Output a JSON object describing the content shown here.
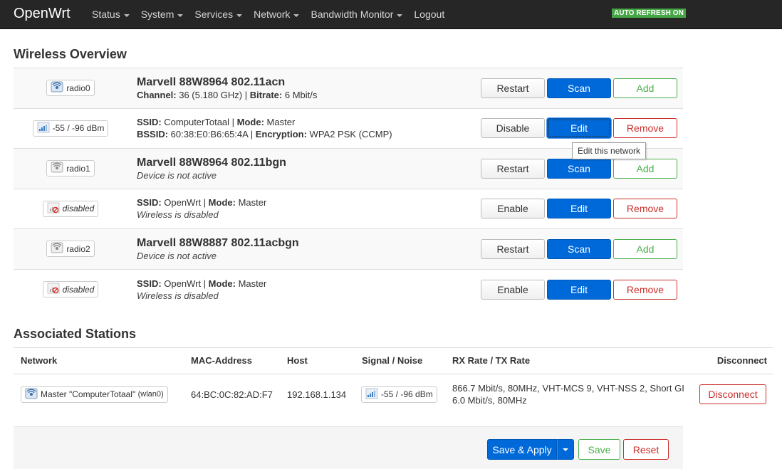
{
  "navbar": {
    "brand": "OpenWrt",
    "menu": [
      {
        "label": "Status",
        "dropdown": true
      },
      {
        "label": "System",
        "dropdown": true
      },
      {
        "label": "Services",
        "dropdown": true
      },
      {
        "label": "Network",
        "dropdown": true
      },
      {
        "label": "Bandwidth Monitor",
        "dropdown": true
      },
      {
        "label": "Logout",
        "dropdown": false
      }
    ],
    "auto_refresh": "AUTO REFRESH ON"
  },
  "wireless": {
    "title": "Wireless Overview",
    "rows": [
      {
        "badge": "radio0",
        "badge_icon": "wifi-radio-active-icon",
        "title": "Marvell 88W8964 802.11acn",
        "l1": {
          "k1": "Channel:",
          "v1": " 36 (5.180 GHz) | ",
          "k2": "Bitrate:",
          "v2": " 6 Mbit/s"
        },
        "buttons": [
          "Restart",
          "Scan",
          "Add"
        ]
      },
      {
        "badge": "-55 / -96 dBm",
        "badge_icon": "signal-bars-icon",
        "l1": {
          "k1": "SSID:",
          "v1": " ComputerTotaal | ",
          "k2": "Mode:",
          "v2": " Master"
        },
        "l2": {
          "k1": "BSSID:",
          "v1": " 60:38:E0:B6:65:4A | ",
          "k2": "Encryption:",
          "v2": " WPA2 PSK (CCMP)"
        },
        "buttons": [
          "Disable",
          "Edit",
          "Remove"
        ]
      },
      {
        "badge": "radio1",
        "badge_icon": "wifi-radio-inactive-icon",
        "title": "Marvell 88W8964 802.11bgn",
        "status": "Device is not active",
        "buttons": [
          "Restart",
          "Scan",
          "Add"
        ]
      },
      {
        "badge": "disabled",
        "badge_icon": "signal-disabled-icon",
        "l1": {
          "k1": "SSID:",
          "v1": " OpenWrt | ",
          "k2": "Mode:",
          "v2": " Master"
        },
        "status": "Wireless is disabled",
        "buttons": [
          "Enable",
          "Edit",
          "Remove"
        ]
      },
      {
        "badge": "radio2",
        "badge_icon": "wifi-radio-inactive-icon",
        "title": "Marvell 88W8887 802.11acbgn",
        "status": "Device is not active",
        "buttons": [
          "Restart",
          "Scan",
          "Add"
        ]
      },
      {
        "badge": "disabled",
        "badge_icon": "signal-disabled-icon",
        "l1": {
          "k1": "SSID:",
          "v1": " OpenWrt | ",
          "k2": "Mode:",
          "v2": " Master"
        },
        "status": "Wireless is disabled",
        "buttons": [
          "Enable",
          "Edit",
          "Remove"
        ]
      }
    ],
    "tooltip": "Edit this network"
  },
  "stations": {
    "title": "Associated Stations",
    "headers": [
      "Network",
      "MAC-Address",
      "Host",
      "Signal / Noise",
      "RX Rate / TX Rate",
      "Disconnect"
    ],
    "rows": [
      {
        "network": "Master \"ComputerTotaal\"",
        "iface": "(wlan0)",
        "mac": "64:BC:0C:82:AD:F7",
        "host": "192.168.1.134",
        "signal": "-55 / -96 dBm",
        "rx": "866.7 Mbit/s, 80MHz, VHT-MCS 9, VHT-NSS 2, Short GI",
        "tx": "6.0 Mbit/s, 80MHz",
        "disconnect": "Disconnect"
      }
    ]
  },
  "actions": {
    "save_apply": "Save & Apply",
    "save": "Save",
    "reset": "Reset"
  },
  "colors": {
    "primary": "#0069d9",
    "positive": "#4cae4c",
    "negative": "#c9302c",
    "navbar": "#262626",
    "refresh_badge": "#46a546"
  }
}
